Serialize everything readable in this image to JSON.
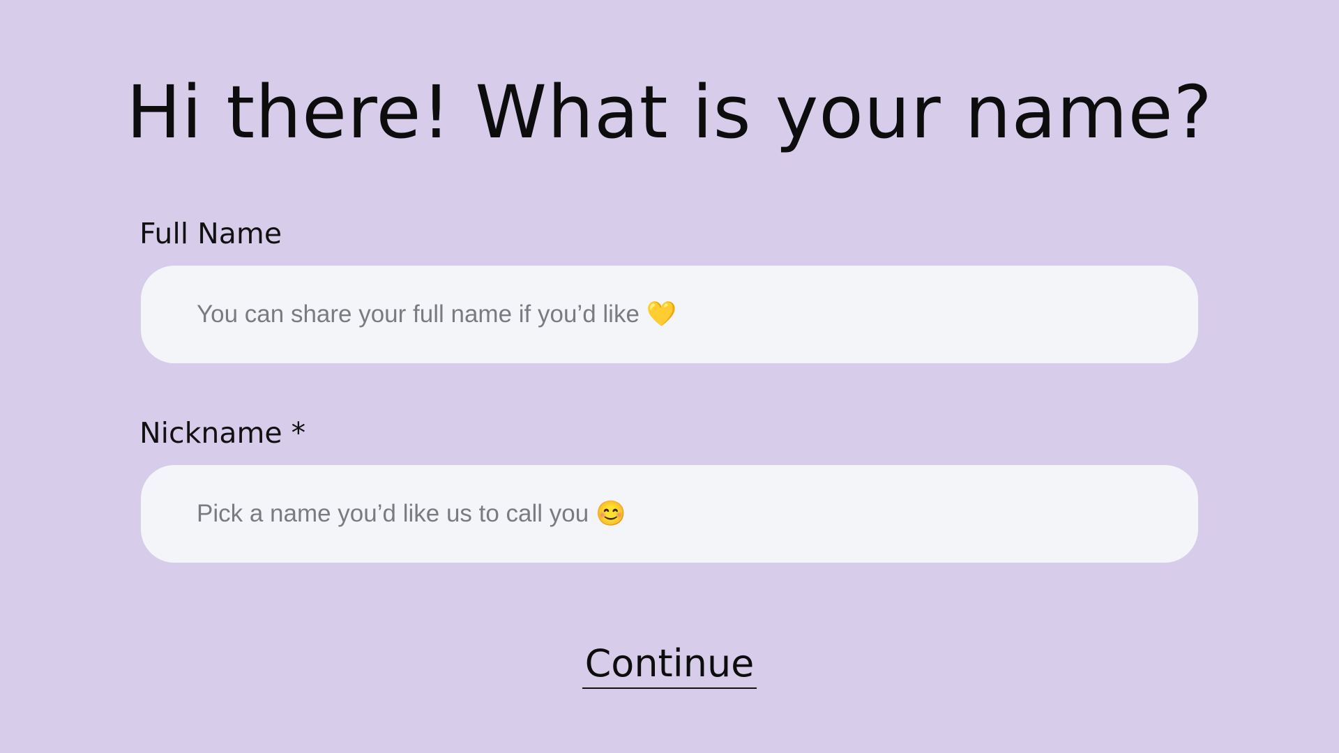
{
  "page": {
    "title": "Hi there! What is your name?"
  },
  "form": {
    "full_name": {
      "label": "Full Name",
      "value": "",
      "placeholder": "You can share your full name if you’d like 💛"
    },
    "nickname": {
      "label": "Nickname *",
      "value": "",
      "placeholder": "Pick a name you’d like us to call you 😊"
    },
    "continue_label": "Continue"
  },
  "colors": {
    "background": "#d7cdeb",
    "field_background": "#f4f5f9",
    "text": "#0d0d0d",
    "placeholder": "#7a7b82"
  }
}
